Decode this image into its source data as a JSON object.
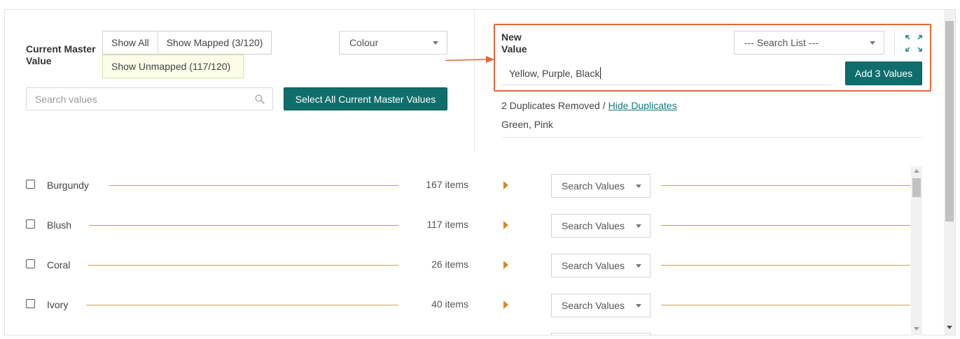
{
  "left_panel": {
    "current_master_label": "Current Master Value",
    "filter_buttons": {
      "show_all": "Show All",
      "show_mapped": "Show Mapped (3/120)",
      "show_unmapped": "Show Unmapped (117/120)"
    },
    "attribute_select": {
      "value": "Colour"
    },
    "search": {
      "placeholder": "Search values"
    },
    "select_all_button": "Select All Current Master Values"
  },
  "right_panel": {
    "new_value_label": "New Value",
    "search_list": {
      "value": "--- Search List ---"
    },
    "expand_icon": "expand-arrows-icon",
    "new_value_input": "Yellow, Purple, Black",
    "add_button": "Add 3 Values",
    "duplicates": {
      "text": "2 Duplicates Removed /",
      "link": "Hide Duplicates",
      "values": "Green, Pink"
    }
  },
  "rows": [
    {
      "name": "Burgundy",
      "count": "167 items",
      "select": "Search Values"
    },
    {
      "name": "Blush",
      "count": "117 items",
      "select": "Search Values"
    },
    {
      "name": "Coral",
      "count": "26 items",
      "select": "Search Values"
    },
    {
      "name": "Ivory",
      "count": "40 items",
      "select": "Search Values"
    }
  ],
  "colors": {
    "teal_button": "#0f6e6b",
    "highlight_border": "#e0683a",
    "connector_line": "#c9a34c",
    "arrow": "#d08a2a",
    "link": "#127a80"
  }
}
